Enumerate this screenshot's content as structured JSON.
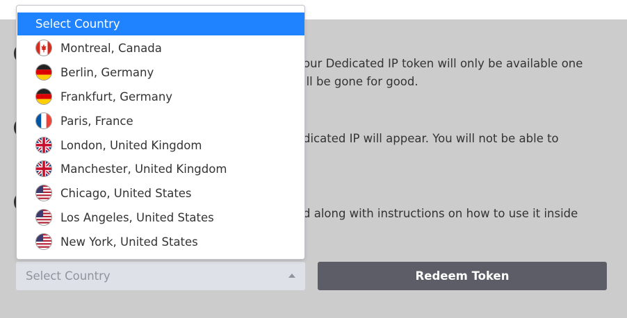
{
  "dropdown": {
    "selected_label": "Select Country",
    "options": [
      {
        "label": "Montreal, Canada",
        "flag": "canada-flag-icon"
      },
      {
        "label": "Berlin, Germany",
        "flag": "germany-flag-icon"
      },
      {
        "label": "Frankfurt, Germany",
        "flag": "germany-flag-icon"
      },
      {
        "label": "Paris, France",
        "flag": "france-flag-icon"
      },
      {
        "label": "London, United Kingdom",
        "flag": "uk-flag-icon"
      },
      {
        "label": "Manchester, United Kingdom",
        "flag": "uk-flag-icon"
      },
      {
        "label": "Chicago, United States",
        "flag": "usa-flag-icon"
      },
      {
        "label": "Los Angeles, United States",
        "flag": "usa-flag-icon"
      },
      {
        "label": "New York, United States",
        "flag": "usa-flag-icon"
      }
    ]
  },
  "instructions": {
    "line1a": "our Dedicated IP token will only be available one",
    "line1b": "ill be gone for good.",
    "line2a": "dicated IP will appear. You will not be able to",
    "line3a": "d along with instructions on how to use it inside"
  },
  "form": {
    "select_placeholder": "Select Country",
    "redeem_label": "Redeem Token"
  },
  "colors": {
    "accent": "#1f82fe",
    "panel": "#cccccc",
    "button": "#5c5d66"
  }
}
